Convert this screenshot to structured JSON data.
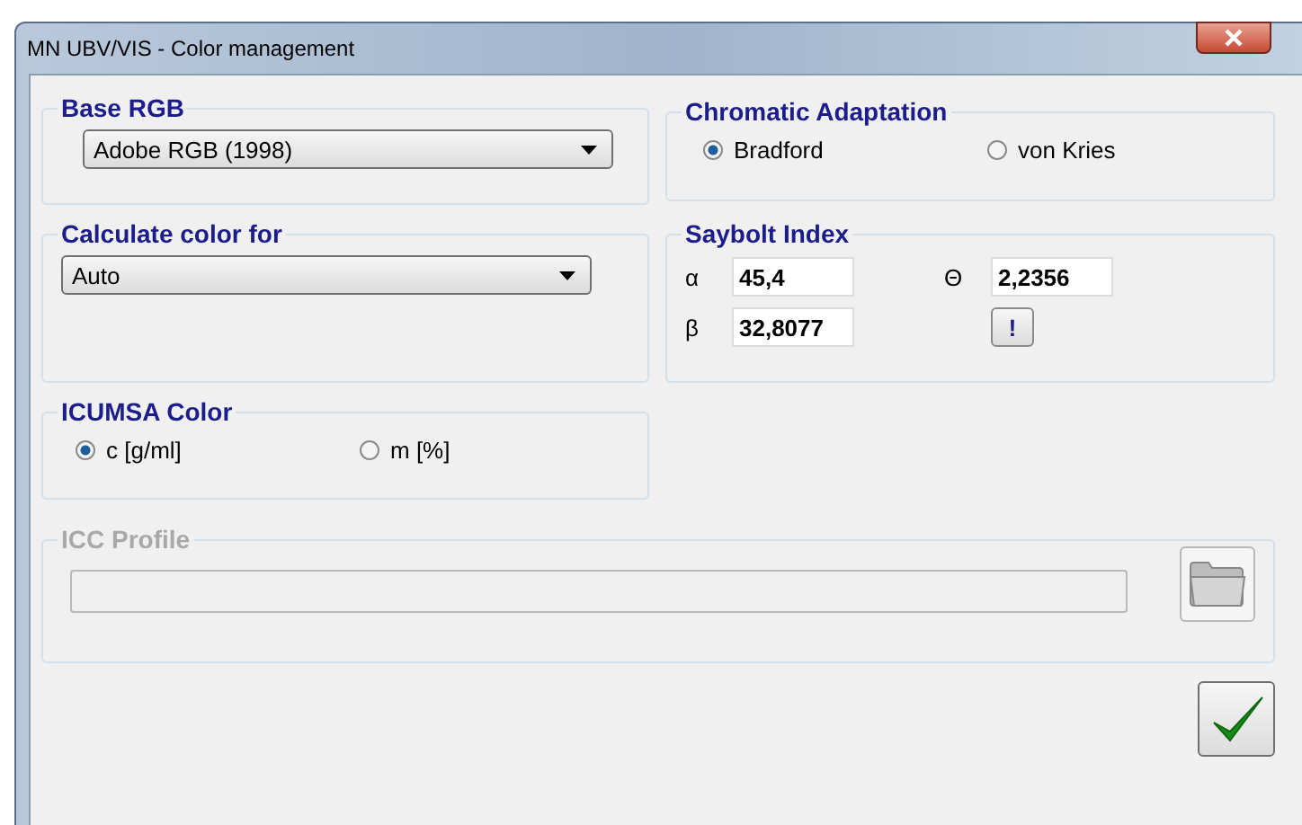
{
  "window": {
    "title": "MN UBV/VIS - Color management"
  },
  "base_rgb": {
    "label": "Base RGB",
    "value": "Adobe RGB (1998)"
  },
  "chromatic_adaptation": {
    "label": "Chromatic Adaptation",
    "options": [
      {
        "label": "Bradford",
        "selected": true
      },
      {
        "label": "von Kries",
        "selected": false
      }
    ]
  },
  "calculate_color_for": {
    "label": "Calculate color for",
    "value": "Auto"
  },
  "saybolt_index": {
    "label": "Saybolt Index",
    "left_fields": [
      {
        "symbol": "α",
        "value": "45,4"
      },
      {
        "symbol": "β",
        "value": "32,8077"
      }
    ],
    "right_field": {
      "symbol": "Θ",
      "value": "2,2356"
    },
    "button": "!"
  },
  "icumsa_color": {
    "label": "ICUMSA Color",
    "options": [
      {
        "label": "c [g/ml]",
        "selected": true
      },
      {
        "label": "m [%]",
        "selected": false
      }
    ]
  },
  "icc_profile": {
    "label": "ICC Profile",
    "disabled": true
  }
}
